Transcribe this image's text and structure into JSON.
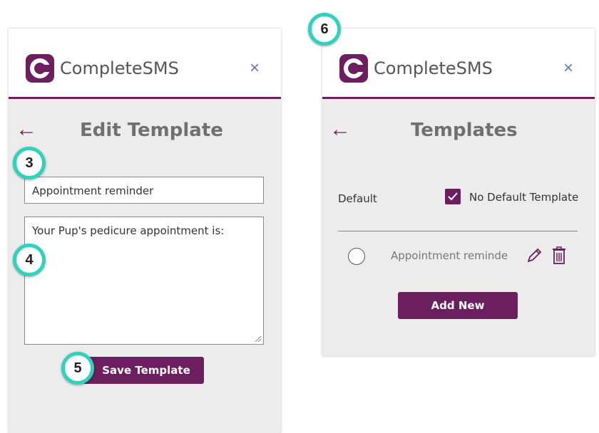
{
  "colors": {
    "brand": "#6b1f5e",
    "accent_badge": "#2fd3bd",
    "close": "#5b7fb0"
  },
  "left_panel": {
    "brand": "CompleteSMS",
    "close_icon": "×",
    "back_icon": "←",
    "title": "Edit Template",
    "name_value": "Appointment reminder",
    "body_value": "Your Pup's pedicure appointment is:",
    "save_label": "Save Template"
  },
  "right_panel": {
    "brand": "CompleteSMS",
    "close_icon": "×",
    "back_icon": "←",
    "title": "Templates",
    "default_label": "Default",
    "no_default_label": "No Default Template",
    "template_item": "Appointment reminde",
    "add_new_label": "Add New"
  },
  "badges": {
    "b3": "3",
    "b4": "4",
    "b5": "5",
    "b6": "6"
  }
}
